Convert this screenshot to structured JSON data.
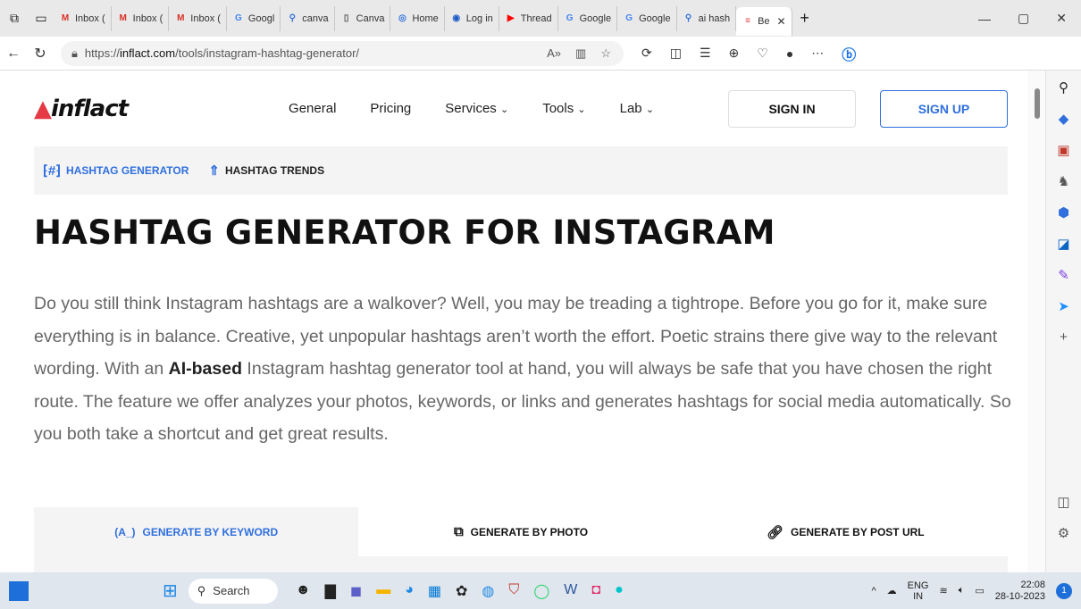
{
  "browser": {
    "tabs": [
      {
        "label": "Inbox (",
        "icon": "gmail-icon"
      },
      {
        "label": "Inbox (",
        "icon": "gmail-icon"
      },
      {
        "label": "Inbox (",
        "icon": "gmail-icon"
      },
      {
        "label": "Googl",
        "icon": "google-icon"
      },
      {
        "label": "canva",
        "icon": "search-icon"
      },
      {
        "label": "Canva",
        "icon": "page-icon"
      },
      {
        "label": "Home",
        "icon": "home-icon"
      },
      {
        "label": "Log in",
        "icon": "chatgpt-icon"
      },
      {
        "label": "Thread",
        "icon": "youtube-icon"
      },
      {
        "label": "Google",
        "icon": "google-icon"
      },
      {
        "label": "Google",
        "icon": "google-icon"
      },
      {
        "label": "ai hash",
        "icon": "search-icon"
      },
      {
        "label": "Be",
        "icon": "inflact-icon"
      }
    ],
    "url_prefix": "https://",
    "url_domain": "inflact.com",
    "url_path": "/tools/instagram-hashtag-generator/"
  },
  "header": {
    "logo": "inflact",
    "nav": [
      "General",
      "Pricing",
      "Services",
      "Tools",
      "Lab"
    ],
    "sign_in": "SIGN IN",
    "sign_up": "SIGN UP"
  },
  "subnav": {
    "hashtag_generator": "HASHTAG GENERATOR",
    "hashtag_trends": "HASHTAG TRENDS"
  },
  "main": {
    "title": "HASHTAG GENERATOR FOR INSTAGRAM",
    "intro_before": "Do you still think Instagram hashtags are a walkover? Well, you may be treading a tightrope. Before you go for it, make sure everything is in balance. Creative, yet unpopular hashtags aren’t worth the effort. Poetic strains there give way to the relevant wording. With an ",
    "intro_bold": "AI-based",
    "intro_after": " Instagram hashtag generator tool at hand, you will always be safe that you have chosen the right route. The feature we offer analyzes your photos, keywords, or links and generates hashtags for social media automatically. So you both take a shortcut and get great results.",
    "tabs": {
      "keyword_icon": "(A_)",
      "keyword": "GENERATE BY KEYWORD",
      "photo": "GENERATE BY PHOTO",
      "url": "GENERATE BY POST URL"
    }
  },
  "taskbar": {
    "search": "Search",
    "lang": "ENG",
    "region": "IN",
    "time": "22:08",
    "date": "28-10-2023",
    "notif": "1"
  },
  "colors": {
    "accent": "#2f6fde",
    "logo_mark": "#e63946"
  }
}
